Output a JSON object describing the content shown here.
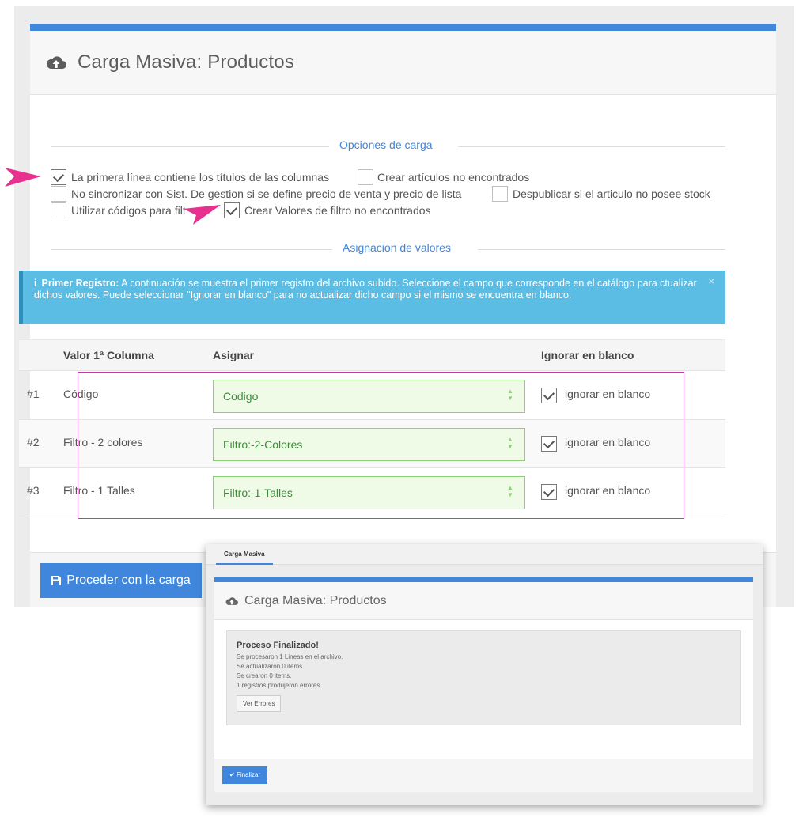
{
  "main": {
    "title": "Carga Masiva: Productos",
    "section_options": "Opciones de carga",
    "section_assign": "Asignacion de valores",
    "options": [
      {
        "label": "La primera línea contiene los títulos de las columnas",
        "checked": true
      },
      {
        "label": "Crear artículos no encontrados",
        "checked": false
      },
      {
        "label": "No sincronizar con Sist. De gestion si se define precio de venta y precio de lista",
        "checked": false
      },
      {
        "label": "Despublicar si el articulo no posee stock",
        "checked": false
      },
      {
        "label": "Utilizar códigos para filt",
        "checked": false
      },
      {
        "label": "Crear Valores de filtro no encontrados",
        "checked": true
      }
    ],
    "alert": {
      "icon": "i",
      "bold": "Primer Registro:",
      "text": "A continuación se muestra el primer registro del archivo subido. Seleccione el campo que corresponde en el catálogo para ctualizar dichos valores. Puede seleccionar \"Ignorar en blanco\" para no actualizar dicho campo si el mismo se encuentra en blanco.",
      "close": "×"
    },
    "table": {
      "headers": [
        "Valor 1ª Columna",
        "Asignar",
        "Ignorar en blanco"
      ],
      "rows": [
        {
          "index": "#1",
          "value": "Código",
          "assign": "Codigo",
          "ignore_label": "ignorar en blanco",
          "ignore_checked": true
        },
        {
          "index": "#2",
          "value": "Filtro - 2 colores",
          "assign": "Filtro:-2-Colores",
          "ignore_label": "ignorar en blanco",
          "ignore_checked": true
        },
        {
          "index": "#3",
          "value": "Filtro - 1 Talles",
          "assign": "Filtro:-1-Talles",
          "ignore_label": "ignorar en blanco",
          "ignore_checked": true
        }
      ]
    },
    "proceed_label": "Proceder con la carga"
  },
  "overlay": {
    "tab": "Carga Masiva",
    "title": "Carga Masiva: Productos",
    "heading": "Proceso Finalizado!",
    "lines": [
      "Se procesaron 1 Lineas en el archivo.",
      "Se actualizaron 0 items.",
      "Se crearon 0 items.",
      "1 registros produjeron errores"
    ],
    "errors_button": "Ver Errores",
    "finish_label": "Finalizar"
  },
  "colors": {
    "accent": "#3f86dc",
    "alert": "#5bbde4",
    "select_bg": "#effbe6",
    "select_border": "#8ed07a",
    "annotation": "#e8308f"
  },
  "icons": [
    "cloud-upload-icon",
    "floppy-icon",
    "check-icon",
    "info-icon",
    "close-icon",
    "select-arrows-icon",
    "pointer-arrow-icon"
  ]
}
